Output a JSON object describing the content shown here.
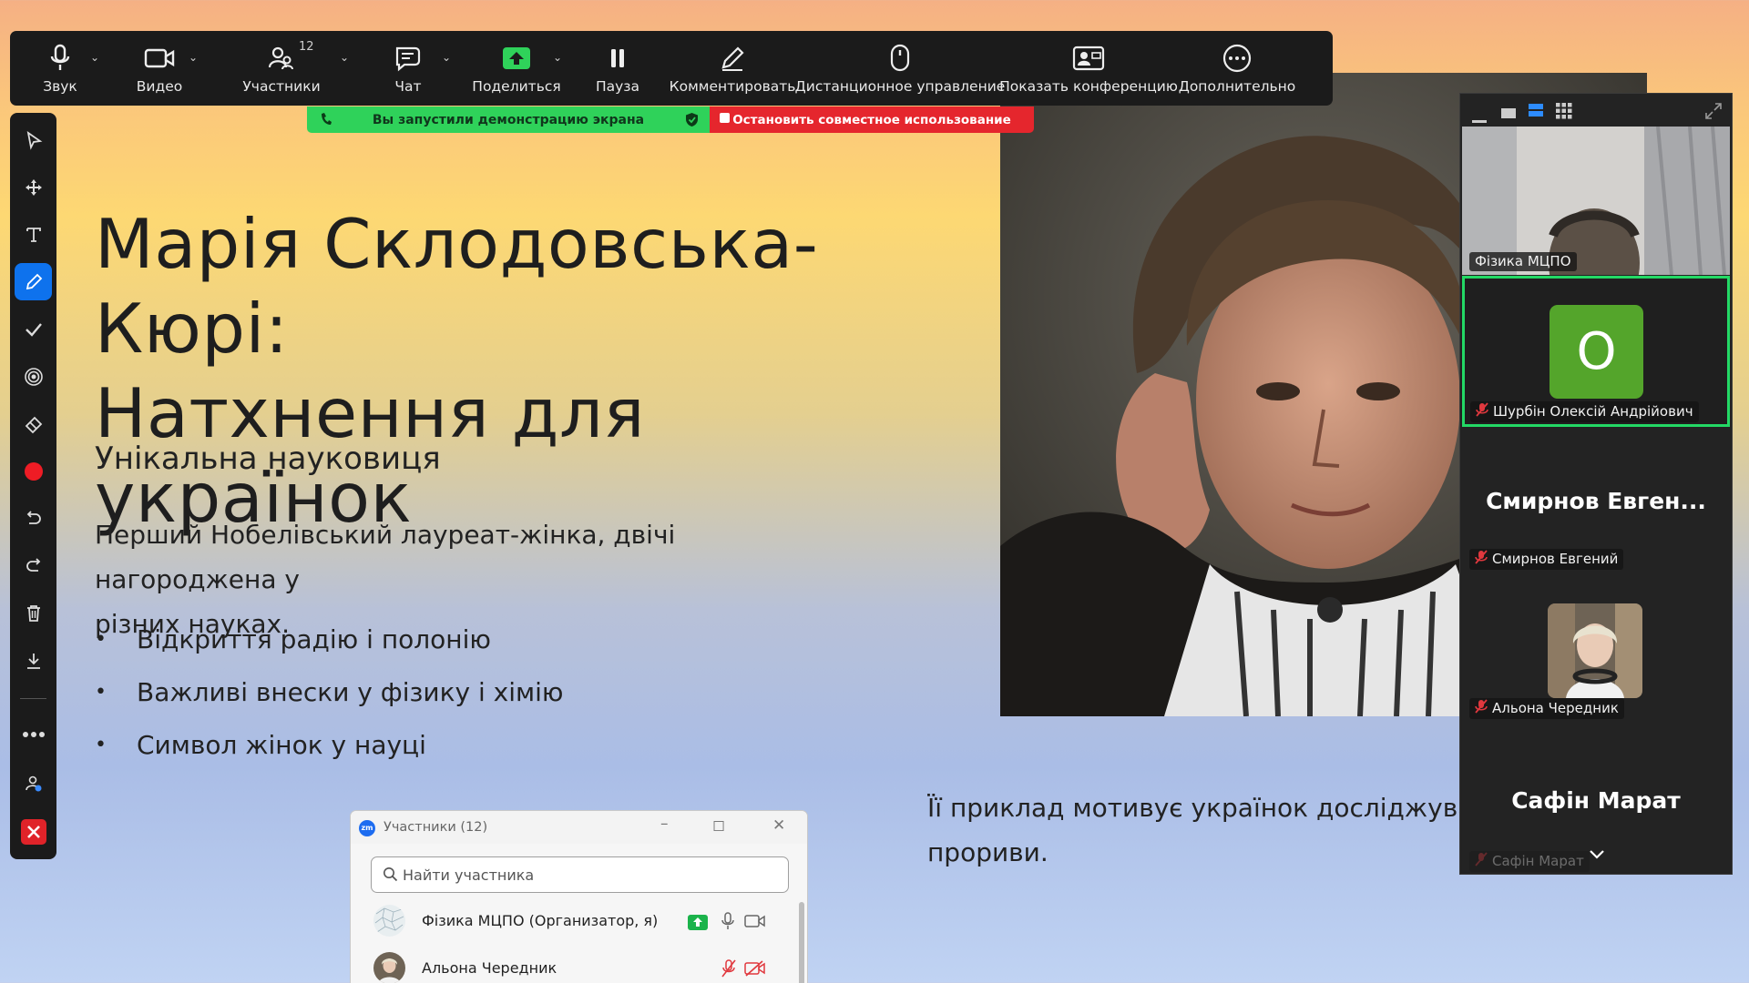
{
  "toolbar": {
    "items": [
      {
        "label": "Звук",
        "icon": "microphone-icon"
      },
      {
        "label": "Видео",
        "icon": "video-camera-icon"
      },
      {
        "label": "Участники",
        "icon": "participants-icon",
        "count": "12"
      },
      {
        "label": "Чат",
        "icon": "chat-icon"
      },
      {
        "label": "Поделиться",
        "icon": "share-screen-icon"
      },
      {
        "label": "Пауза",
        "icon": "pause-icon"
      },
      {
        "label": "Комментировать",
        "icon": "annotate-pen-icon"
      },
      {
        "label": "Дистанционное управление",
        "icon": "remote-control-mouse-icon"
      },
      {
        "label": "Показать конференцию",
        "icon": "show-meeting-icon"
      },
      {
        "label": "Дополнительно",
        "icon": "more-icon"
      }
    ],
    "accent": "#2fd25a"
  },
  "share_banner": {
    "status": "Вы запустили демонстрацию экрана",
    "stop_label": "Остановить совместное использование",
    "status_color": "#2fd25a",
    "stop_color": "#e5262d"
  },
  "annotation_tools": [
    "select-arrow-icon",
    "move-icon",
    "text-icon",
    "pen-icon",
    "stamp-check-icon",
    "spotlight-icon",
    "eraser-icon",
    "color-red-icon",
    "undo-icon",
    "redo-icon",
    "delete-trash-icon",
    "save-download-icon",
    "more-dots-icon",
    "user-annotator-icon",
    "close-annotation-icon"
  ],
  "slide": {
    "title_line1": "Марія Склодовська-Кюрі:",
    "title_line2": "Натхнення для українок",
    "subtitle": "Унікальна науковиця",
    "paragraph_line1": "Перший Нобелівський лауреат-жінка, двічі нагороджена у",
    "paragraph_line2": "різних науках.",
    "bullets": [
      "Відкриття радію і полонію",
      "Важливі внески у фізику і хімію",
      "Символ жінок у науці"
    ],
    "paragraph2_line1": "Її приклад мотивує українок досліджувати",
    "paragraph2_line2": "прориви."
  },
  "video_panel": {
    "tiles": [
      {
        "name": "Фізика МЦПО",
        "type": "video"
      },
      {
        "name": "Шурбін Олексій Андрійович",
        "avatar_letter": "O",
        "avatar_color": "#54a52b",
        "muted": true,
        "active_speaker": true
      },
      {
        "name": "Смирнов Евгений",
        "display": "Смирнов  Евген...",
        "muted": true
      },
      {
        "name": "Альона Чередник",
        "type": "photo",
        "muted": true
      },
      {
        "name": "Сафін Марат",
        "display": "Сафін Марат",
        "muted": true
      }
    ]
  },
  "participants_window": {
    "title": "Участники (12)",
    "search_placeholder": "Найти участника",
    "rows": [
      {
        "name": "Фізика МЦПО (Организатор, я)",
        "sharing": true,
        "mic_on": true,
        "video_off": false
      },
      {
        "name": "Альона Чередник",
        "sharing": false,
        "mic_on": false,
        "video_off": true
      }
    ]
  }
}
